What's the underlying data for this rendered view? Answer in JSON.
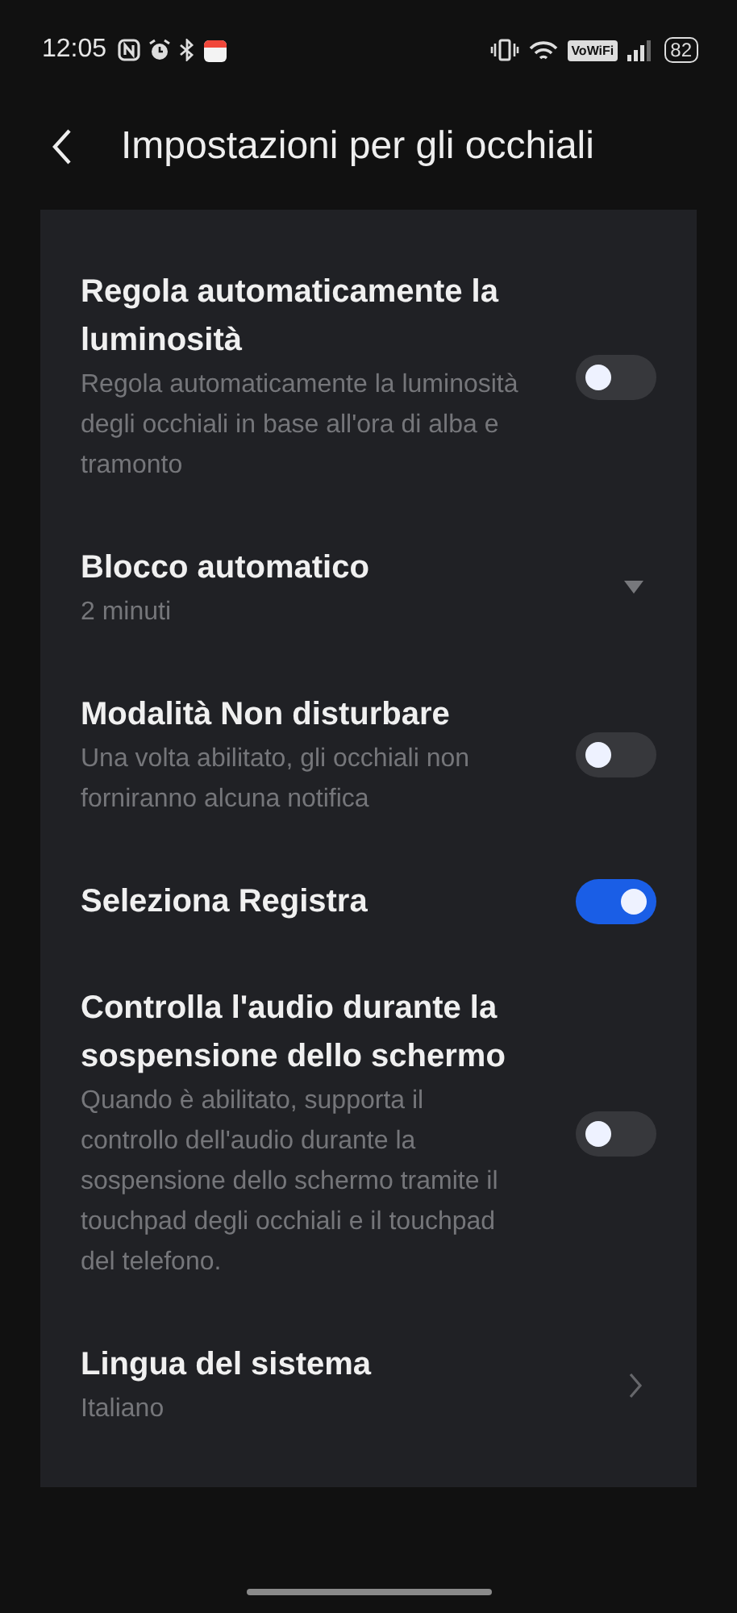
{
  "status_bar": {
    "time": "12:05",
    "wifi_badge": "VoWiFi",
    "battery": "82"
  },
  "header": {
    "title": "Impostazioni per gli occhiali"
  },
  "settings": [
    {
      "kind": "toggle",
      "title": "Regola automaticamente la luminosità",
      "description": "Regola automaticamente la luminosità degli occhiali in base all'ora di alba e tramonto",
      "on": false
    },
    {
      "kind": "dropdown",
      "title": "Blocco automatico",
      "value": "2 minuti"
    },
    {
      "kind": "toggle",
      "title": "Modalità Non disturbare",
      "description": "Una volta abilitato, gli occhiali non forniranno alcuna notifica",
      "on": false
    },
    {
      "kind": "toggle",
      "title": "Seleziona Registra",
      "on": true
    },
    {
      "kind": "toggle",
      "title": "Controlla l'audio durante la sospensione dello schermo",
      "description": "Quando è abilitato, supporta il controllo dell'audio durante la sospensione dello schermo tramite il touchpad degli occhiali e il touchpad del telefono.",
      "on": false
    },
    {
      "kind": "link",
      "title": "Lingua del sistema",
      "value": "Italiano"
    }
  ]
}
